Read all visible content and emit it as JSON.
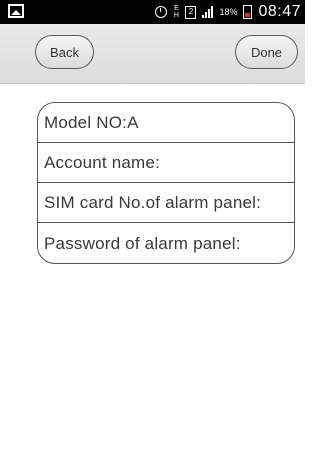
{
  "status_bar": {
    "sim_slot_label": "E",
    "sim_slot_sub": "H",
    "sim_number": "2",
    "battery_percent": "18%",
    "time": "08:47"
  },
  "nav": {
    "back_label": "Back",
    "done_label": "Done"
  },
  "form": {
    "rows": [
      {
        "label": "Model NO:",
        "value": "A"
      },
      {
        "label": "Account name:",
        "value": ""
      },
      {
        "label": "SIM card No.of alarm panel:",
        "value": ""
      },
      {
        "label": "Password of alarm panel:",
        "value": ""
      }
    ]
  }
}
